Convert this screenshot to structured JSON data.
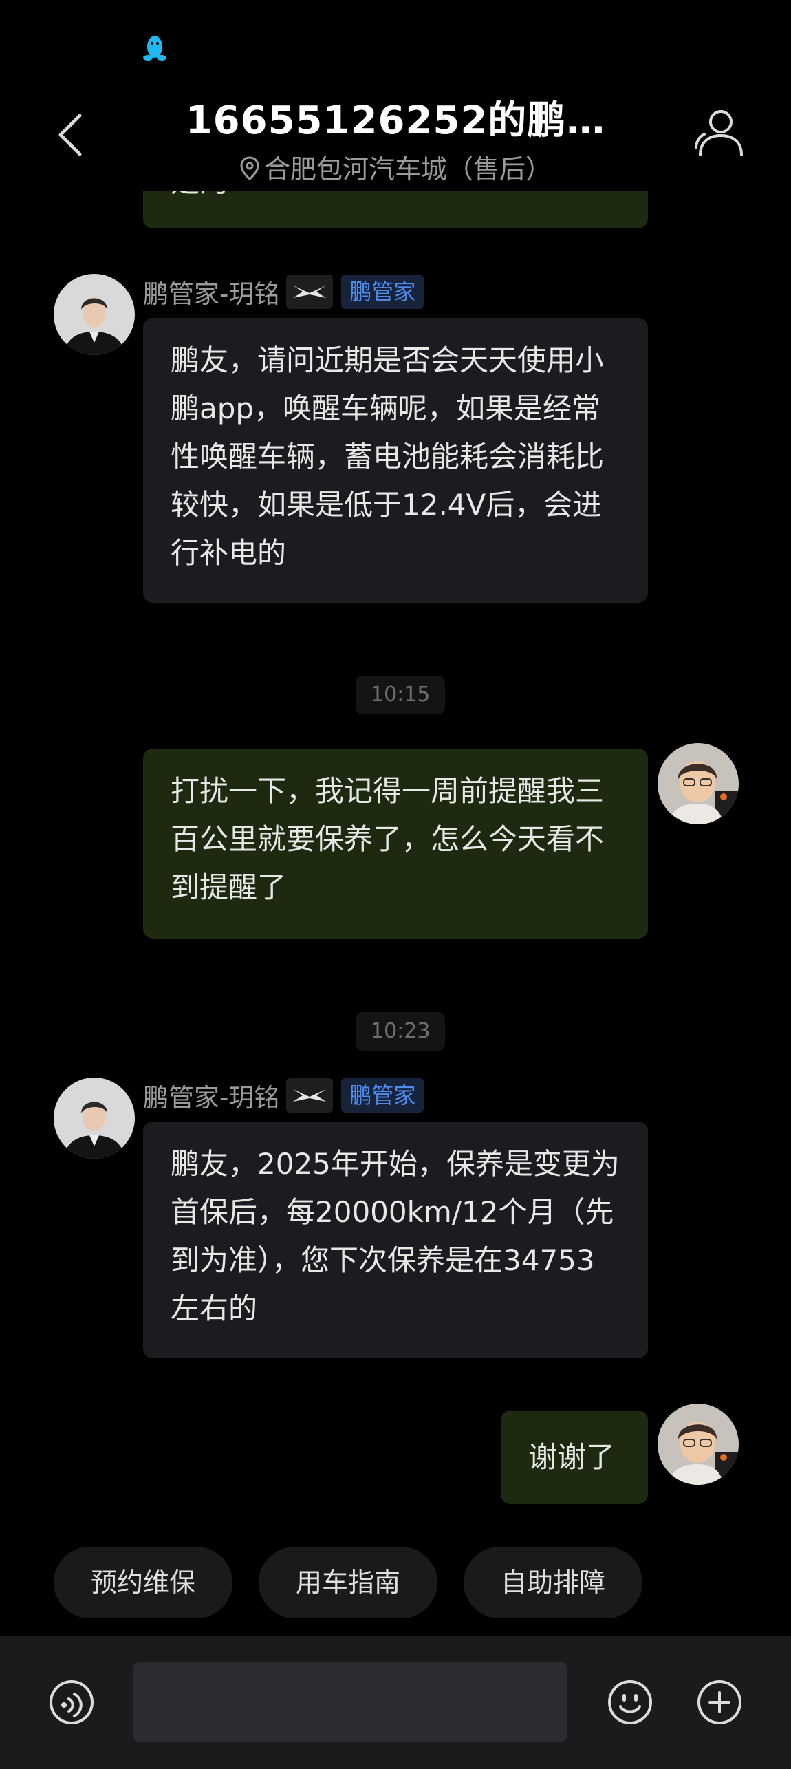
{
  "header": {
    "title": "16655126252的鹏…",
    "location": "合肥包河汽车城（售后）",
    "icons": {
      "back": "chevron-left-icon",
      "profile": "person-icon",
      "location": "location-pin-icon",
      "status": "qq-penguin-icon"
    }
  },
  "messages": {
    "m0": {
      "text": "是的"
    },
    "m1": {
      "sender": "鹏管家-玥铭",
      "tag": "鹏管家",
      "text": "鹏友，请问近期是否会天天使用小鹏app，唤醒车辆呢，如果是经常性唤醒车辆，蓄电池能耗会消耗比较快，如果是低于12.4V后，会进行补电的"
    },
    "t1": "10:15",
    "m2": {
      "text": "打扰一下，我记得一周前提醒我三百公里就要保养了，怎么今天看不到提醒了"
    },
    "t2": "10:23",
    "m3": {
      "sender": "鹏管家-玥铭",
      "tag": "鹏管家",
      "text": "鹏友，2025年开始，保养是变更为首保后，每20000km/12个月（先到为准），您下次保养是在34753左右的"
    },
    "m4": {
      "text": "谢谢了"
    }
  },
  "quick_actions": [
    "预约维保",
    "用车指南",
    "自助排障"
  ],
  "input": {
    "value": "",
    "placeholder": ""
  },
  "colors": {
    "background": "#000000",
    "bubble_them": "#1b1c20",
    "bubble_me": "#1e2a10",
    "tag_text": "#4f8cf0",
    "tag_bg": "#16233a",
    "bottom_bar": "#1a1b1d"
  }
}
